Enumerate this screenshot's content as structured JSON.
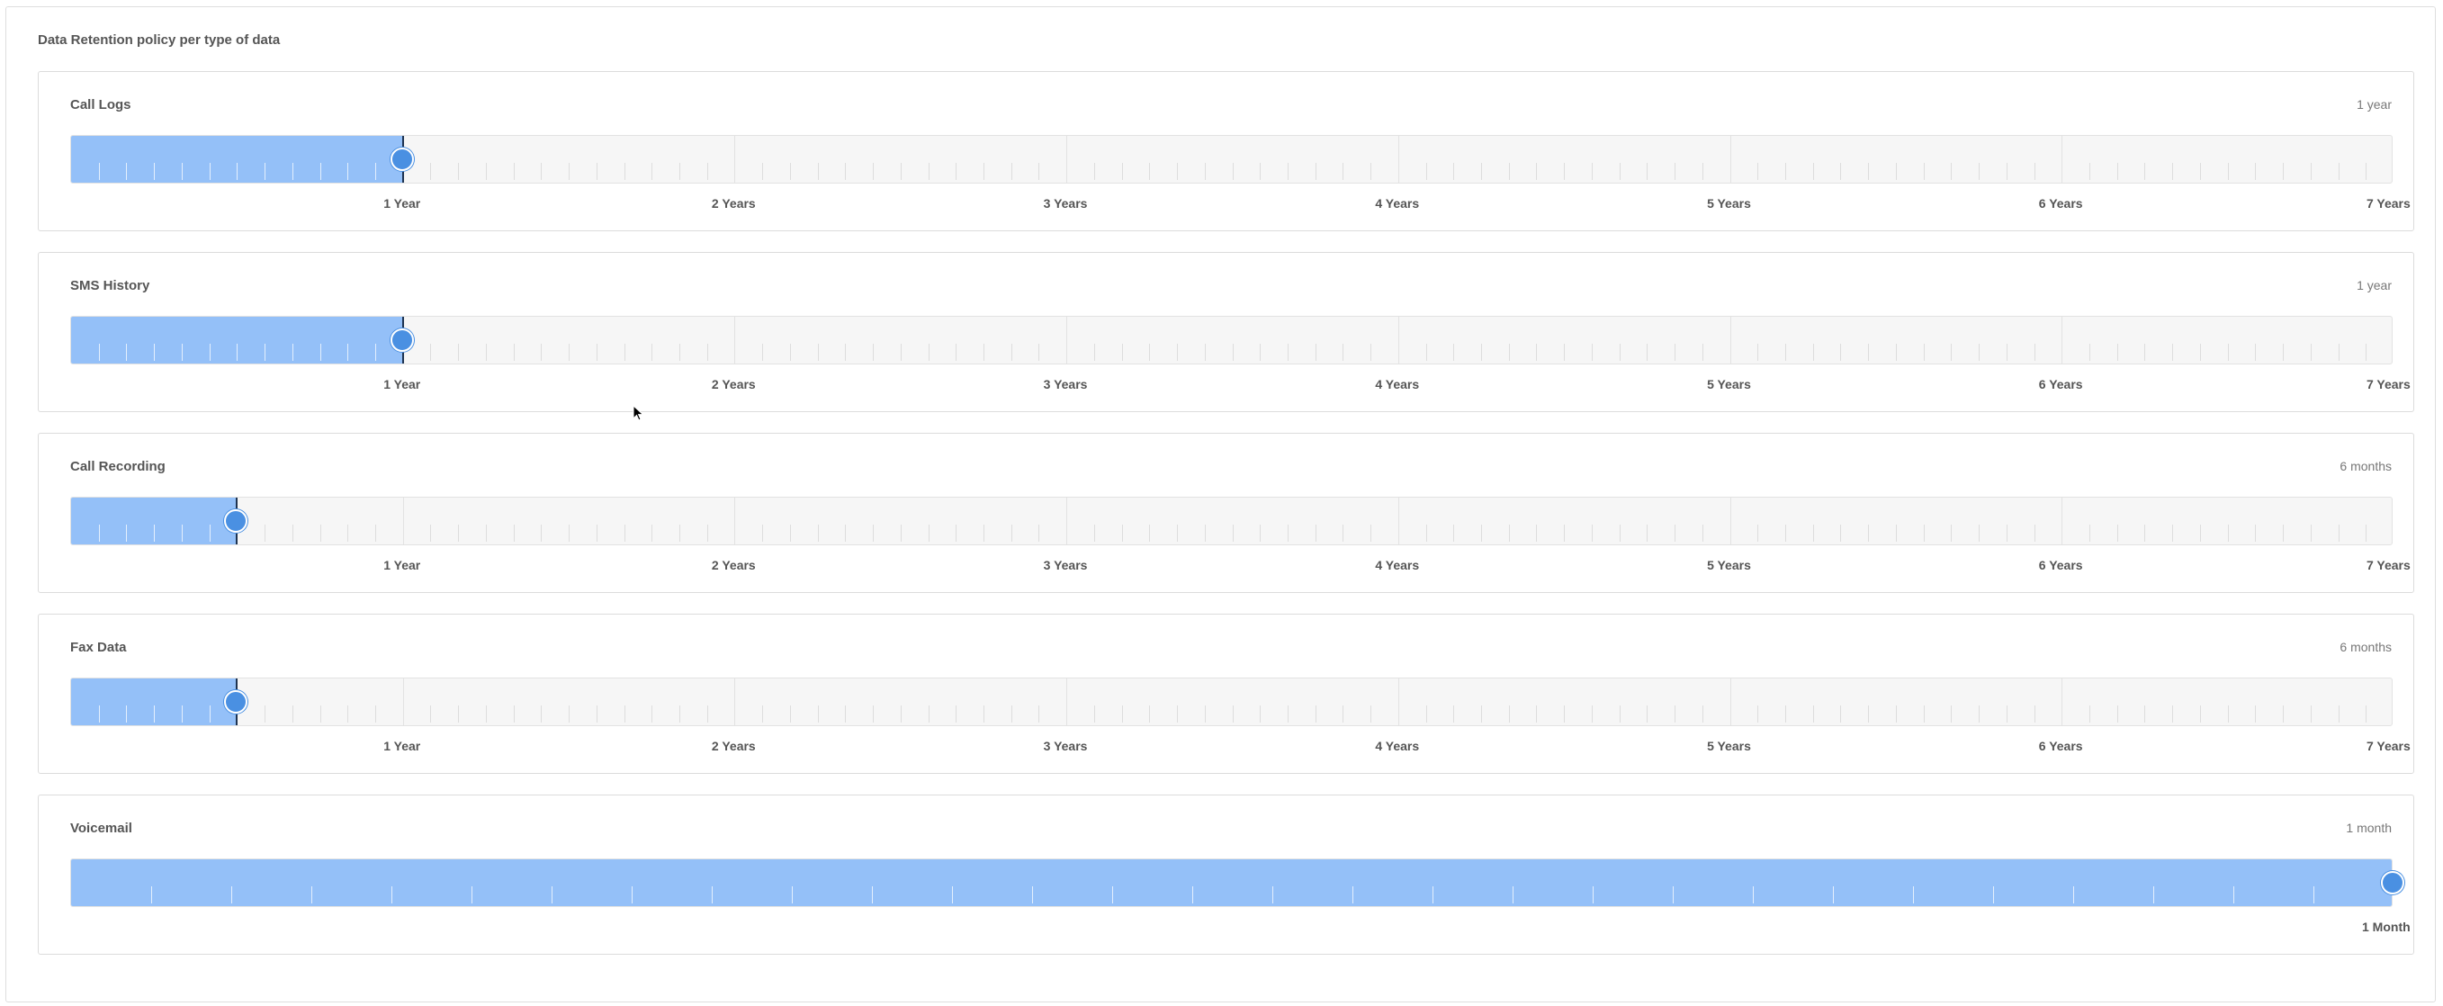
{
  "section_title": "Data Retention policy per type of data",
  "colors": {
    "fill": "#94c0f8",
    "handle": "#4a90e2",
    "track": "#f6f6f6"
  },
  "year_labels": [
    "1 Year",
    "2 Years",
    "3 Years",
    "4 Years",
    "5 Years",
    "6 Years",
    "7 Years"
  ],
  "sliders": [
    {
      "label": "Call Logs",
      "value_text": "1 year",
      "max_months": 84,
      "value_months": 12,
      "scale_labels": [
        "1 Year",
        "2 Years",
        "3 Years",
        "4 Years",
        "5 Years",
        "6 Years",
        "7 Years"
      ]
    },
    {
      "label": "SMS History",
      "value_text": "1 year",
      "max_months": 84,
      "value_months": 12,
      "scale_labels": [
        "1 Year",
        "2 Years",
        "3 Years",
        "4 Years",
        "5 Years",
        "6 Years",
        "7 Years"
      ]
    },
    {
      "label": "Call Recording",
      "value_text": "6 months",
      "max_months": 84,
      "value_months": 6,
      "scale_labels": [
        "1 Year",
        "2 Years",
        "3 Years",
        "4 Years",
        "5 Years",
        "6 Years",
        "7 Years"
      ]
    },
    {
      "label": "Fax Data",
      "value_text": "6 months",
      "max_months": 84,
      "value_months": 6,
      "scale_labels": [
        "1 Year",
        "2 Years",
        "3 Years",
        "4 Years",
        "5 Years",
        "6 Years",
        "7 Years"
      ]
    },
    {
      "label": "Voicemail",
      "value_text": "1 month",
      "max_months": 1,
      "value_months": 1,
      "scale_labels": [
        "1 Month"
      ]
    }
  ]
}
